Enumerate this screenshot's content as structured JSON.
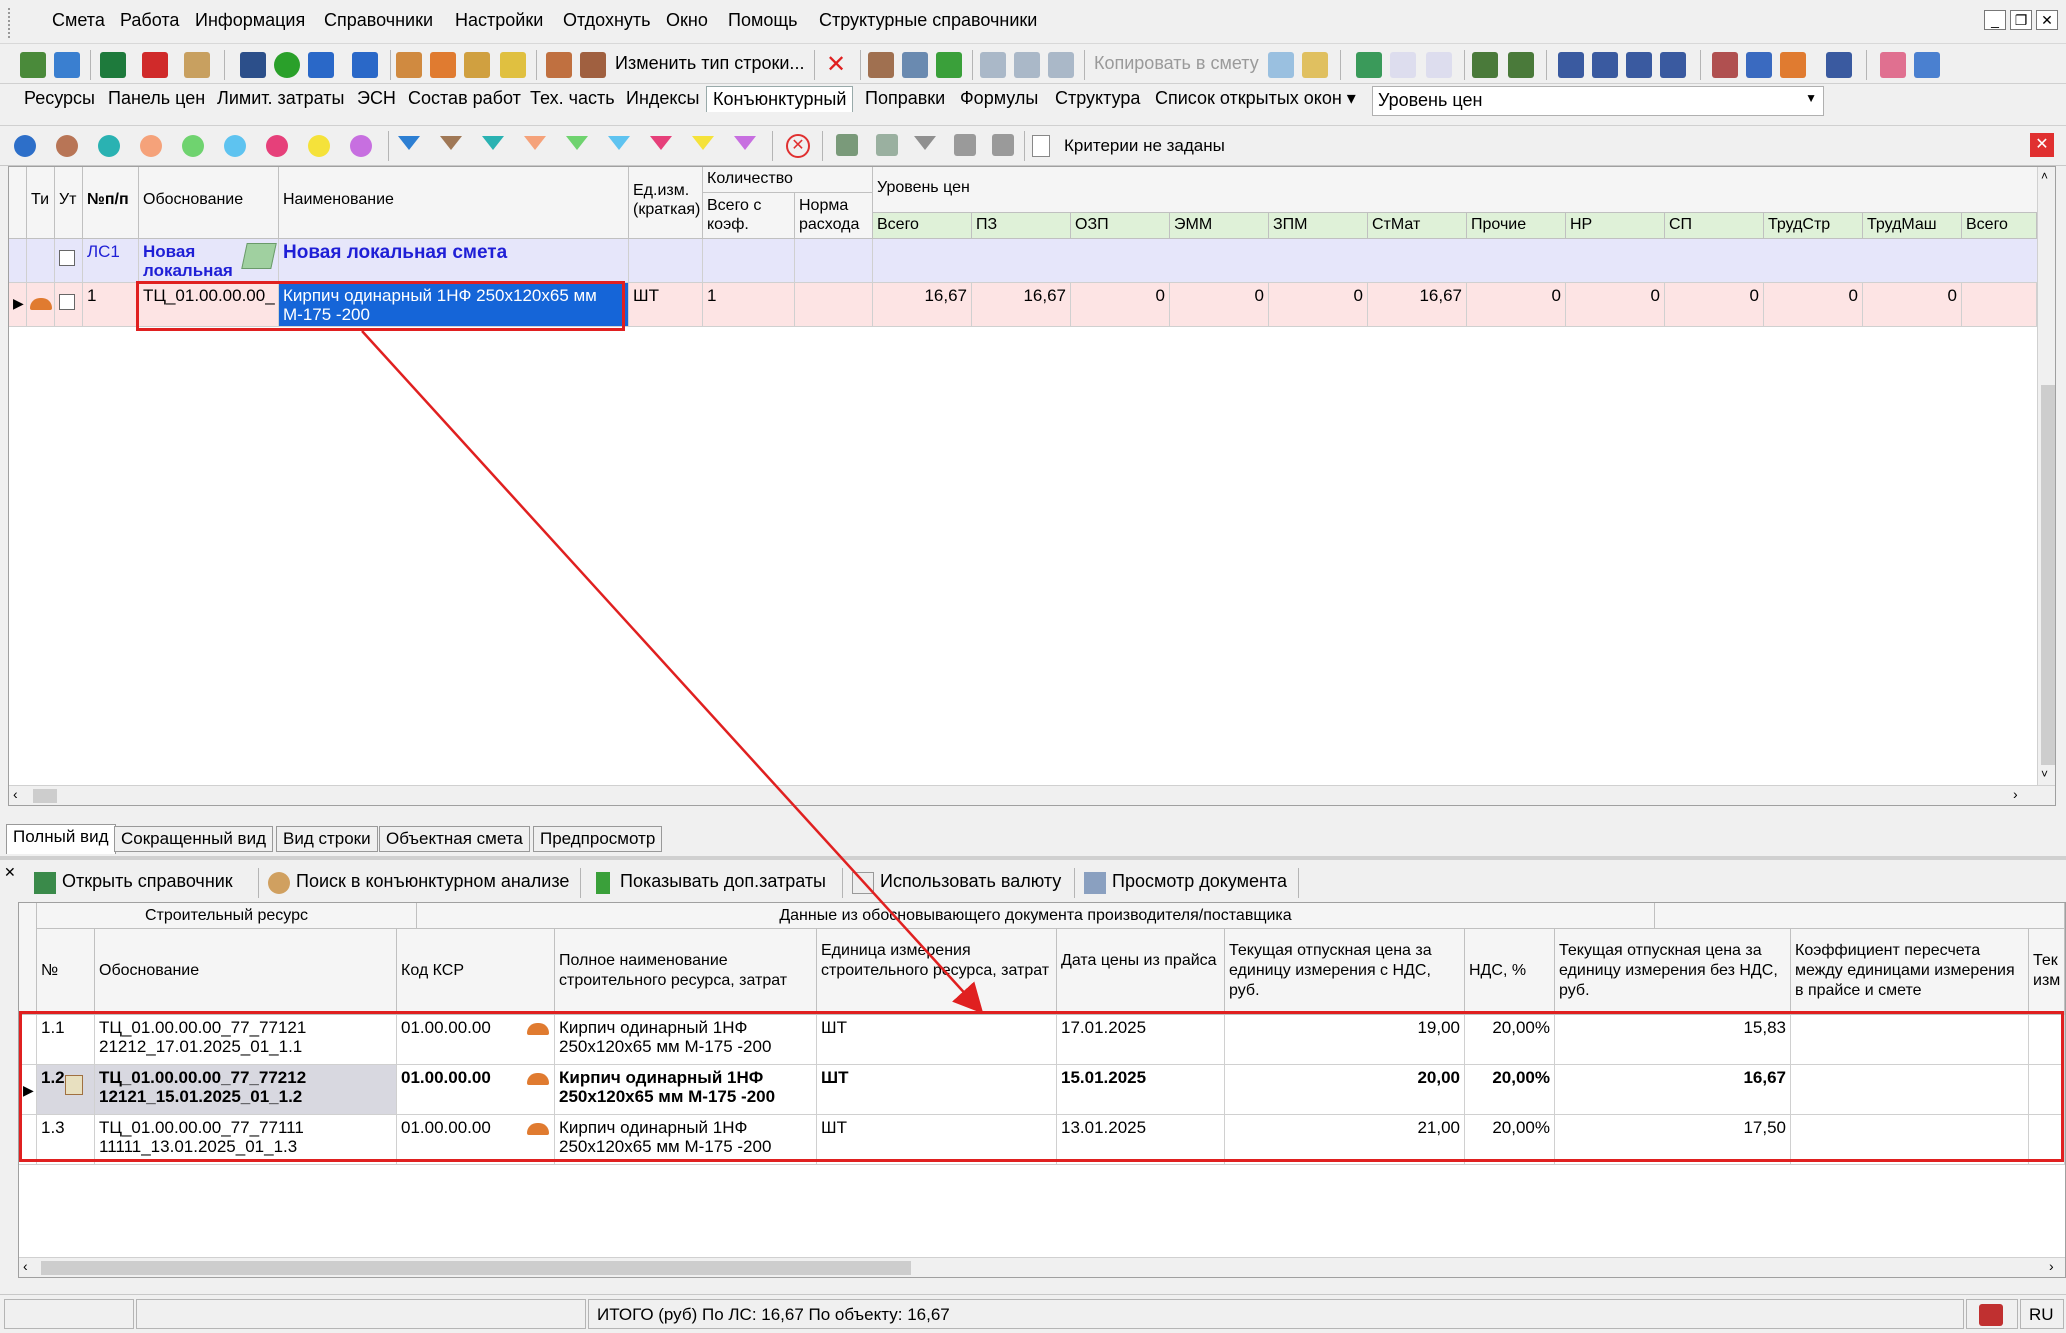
{
  "menu": [
    "Смета",
    "Работа",
    "Информация",
    "Справочники",
    "Настройки",
    "Отдохнуть",
    "Окно",
    "Помощь",
    "Структурные справочники"
  ],
  "toolbar1": {
    "change_row_type": "Изменить тип строки...",
    "copy_to_estimate": "Копировать в смету"
  },
  "toolbar2": {
    "tabs": [
      "Ресурсы",
      "Панель цен",
      "Лимит. затраты",
      "ЭСН",
      "Состав работ",
      "Тех. часть",
      "Индексы",
      "Конъюнктурный",
      "Поправки",
      "Формулы",
      "Структура",
      "Список открытых окон ▾"
    ],
    "price_level_select": "Уровень цен"
  },
  "filterbar": {
    "dot_colors": [
      "#2d6fc9",
      "#b87556",
      "#2ab2b2",
      "#f5a27a",
      "#6fd36f",
      "#5ec3f0",
      "#e6407a",
      "#f5e23a",
      "#c76fe0"
    ],
    "funnel_colors": [
      "#2d7fd3",
      "#a07856",
      "#2ab2b2",
      "#f5a27a",
      "#6fd36f",
      "#5ec3f0",
      "#e6407a",
      "#f5e23a",
      "#c76fe0"
    ],
    "criteria_text": "Критерии не заданы"
  },
  "grid1": {
    "headers": {
      "ti": "Ти",
      "ut": "Ут",
      "num": "№п/п",
      "basis": "Обоснование",
      "name": "Наименование",
      "unit": "Ед.изм. (краткая)",
      "qty": "Количество",
      "qty_total": "Всего с коэф.",
      "qty_norm": "Норма расхода",
      "price_level": "Уровень цен",
      "price_cols": [
        "Всего",
        "ПЗ",
        "ОЗП",
        "ЭММ",
        "ЗПМ",
        "СтМат",
        "Прочие",
        "НР",
        "СП",
        "ТрудСтр",
        "ТрудМаш",
        "Всего"
      ]
    },
    "row_lc": {
      "num": "ЛС1",
      "basis": "Новая локальная",
      "name": "Новая локальная смета"
    },
    "row_item": {
      "num": "1",
      "basis": "ТЦ_01.00.00.00_",
      "name": "Кирпич одинарный 1НФ 250x120x65 мм М-175 -200",
      "unit": "ШТ",
      "qty_total": "1",
      "prices": [
        "16,67",
        "16,67",
        "0",
        "0",
        "0",
        "16,67",
        "0",
        "0",
        "0",
        "0",
        "0",
        ""
      ]
    }
  },
  "bottom_tabs": [
    "Полный вид",
    "Сокращенный вид",
    "Вид строки",
    "Объектная смета",
    "Предпросмотр"
  ],
  "lowerbar": {
    "open_reference": "Открыть справочник",
    "search_conj": "Поиск в конъюнктурном анализе",
    "show_extra": "Показывать доп.затраты",
    "use_currency": "Использовать валюту",
    "view_document": "Просмотр документа"
  },
  "grid2": {
    "group1": "Строительный ресурс",
    "group2": "Данные из обосновывающего документа производителя/поставщика",
    "headers": {
      "num": "№",
      "basis": "Обоснование",
      "ksr": "Код КСР",
      "fullname": "Полное наименование строительного ресурса, затрат",
      "unit": "Единица измерения строительного ресурса, затрат",
      "date": "Дата цены из прайса",
      "price_vat": "Текущая отпускная цена за единицу измерения с НДС, руб.",
      "vat": "НДС, %",
      "price_novat": "Текущая отпускная цена за единицу измерения без НДС, руб.",
      "coef": "Коэффициент пересчета между единицами измерения в прайсе и смете",
      "cut": "Тек изм"
    },
    "rows": [
      {
        "num": "1.1",
        "basis": "ТЦ_01.00.00.00_77_77121 21212_17.01.2025_01_1.1",
        "ksr": "01.00.00.00",
        "fullname": "Кирпич одинарный 1НФ 250x120x65 мм М-175 -200",
        "unit": "ШТ",
        "date": "17.01.2025",
        "price_vat": "19,00",
        "vat": "20,00%",
        "price_novat": "15,83"
      },
      {
        "num": "1.2",
        "basis": "ТЦ_01.00.00.00_77_77212 12121_15.01.2025_01_1.2",
        "ksr": "01.00.00.00",
        "fullname": "Кирпич одинарный 1НФ 250x120x65 мм М-175 -200",
        "unit": "ШТ",
        "date": "15.01.2025",
        "price_vat": "20,00",
        "vat": "20,00%",
        "price_novat": "16,67"
      },
      {
        "num": "1.3",
        "basis": "ТЦ_01.00.00.00_77_77111 11111_13.01.2025_01_1.3",
        "ksr": "01.00.00.00",
        "fullname": "Кирпич одинарный 1НФ 250x120x65 мм М-175 -200",
        "unit": "ШТ",
        "date": "13.01.2025",
        "price_vat": "21,00",
        "vat": "20,00%",
        "price_novat": "17,50"
      }
    ]
  },
  "status": {
    "total": "ИТОГО (руб)  По ЛС: 16,67     По объекту: 16,67",
    "lang": "RU"
  },
  "colors": {
    "selection": "#1565d8",
    "highlight": "#e02020",
    "lc_row": "#e6e6fa",
    "item_row": "#fde4e4",
    "lc_text": "#1f1fd6"
  }
}
